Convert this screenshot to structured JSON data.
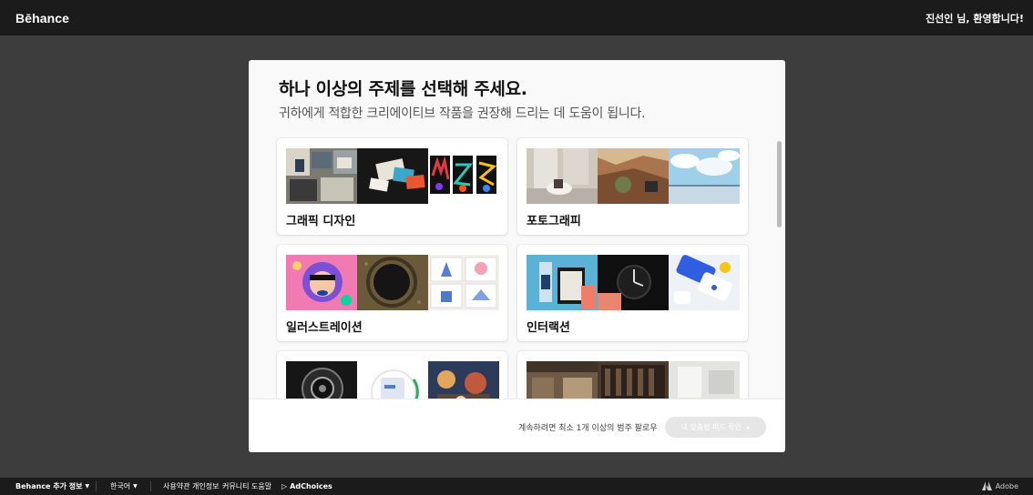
{
  "header": {
    "logo": "Bēhance",
    "welcome": "진선인 님, 환영합니다!"
  },
  "modal": {
    "title": "하나 이상의 주제를 선택해 주세요.",
    "subtitle": "귀하에게 적합한 크리에이티브 작품을 권장해 드리는 데 도움이 됩니다.",
    "categories": [
      {
        "label": "그래픽 디자인"
      },
      {
        "label": "포토그래피"
      },
      {
        "label": "일러스트레이션"
      },
      {
        "label": "인터랙션"
      },
      {
        "label": ""
      },
      {
        "label": ""
      }
    ],
    "footer_text": "계속하려면 최소 1개 이상의 범주 팔로우",
    "cta_label": "내 맞춤형 피드 확인"
  },
  "footer": {
    "more_info": "Behance 추가 정보",
    "language": "한국어",
    "links": [
      "사용약관",
      "개인정보",
      "커뮤니티",
      "도움말"
    ],
    "adchoices": "AdChoices",
    "adobe": "Adobe"
  },
  "colors": {
    "page_bg": "#3d3d3d",
    "topbar_bg": "#1b1b1b",
    "modal_bg": "#f9f9f9",
    "cta_disabled": "#e6e6e6"
  }
}
